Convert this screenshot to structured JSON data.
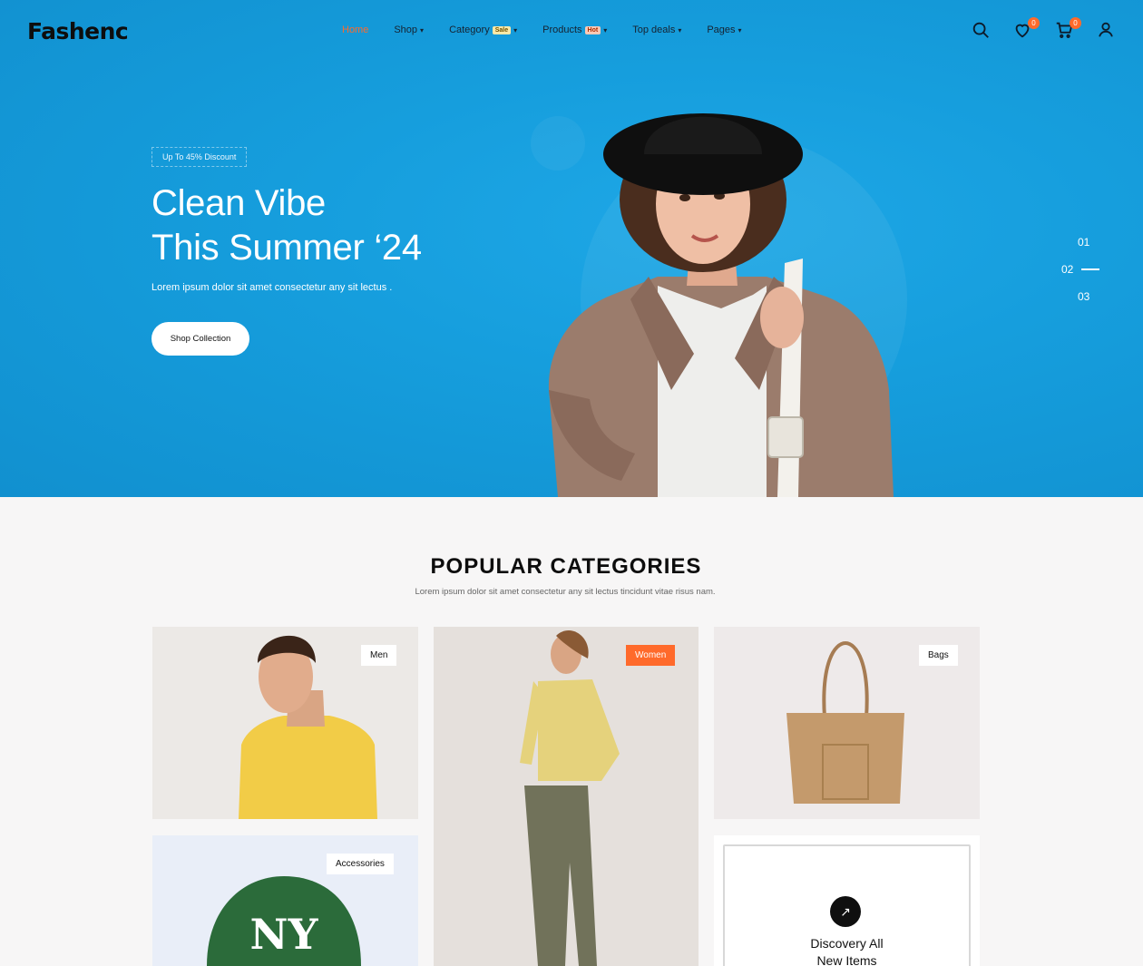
{
  "brand": {
    "logo": "Fashenc"
  },
  "nav": {
    "items": [
      {
        "label": "Home",
        "active": true
      },
      {
        "label": "Shop",
        "caret": true
      },
      {
        "label": "Category",
        "tag": "Sale",
        "caret": true
      },
      {
        "label": "Products",
        "tag": "Hot",
        "caret": true
      },
      {
        "label": "Top deals",
        "caret": true
      },
      {
        "label": "Pages",
        "caret": true
      }
    ],
    "wishlist_count": "0",
    "cart_count": "0"
  },
  "hero": {
    "tag": "Up To 45% Discount",
    "title_line1": "Clean Vibe",
    "title_line2": "This Summer ‘24",
    "subtitle": "Lorem ipsum dolor sit amet consectetur any sit lectus .",
    "button": "Shop Collection",
    "slides": [
      "01",
      "02",
      "03"
    ],
    "active_slide": "02"
  },
  "categories": {
    "title": "POPULAR CATEGORIES",
    "subtitle": "Lorem ipsum dolor sit amet consectetur any sit lectus tincidunt vitae risus nam.",
    "men": "Men",
    "women": "Women",
    "bags": "Bags",
    "accessories": "Accessories",
    "discover_line1": "Discovery All",
    "discover_line2": "New Items"
  },
  "colors": {
    "hero_blue": "#169edd",
    "accent": "#ff6a2b",
    "section_bg": "#f7f6f6"
  },
  "icons": [
    "search-icon",
    "heart-icon",
    "cart-icon",
    "user-icon",
    "arrow-up-right-icon"
  ]
}
